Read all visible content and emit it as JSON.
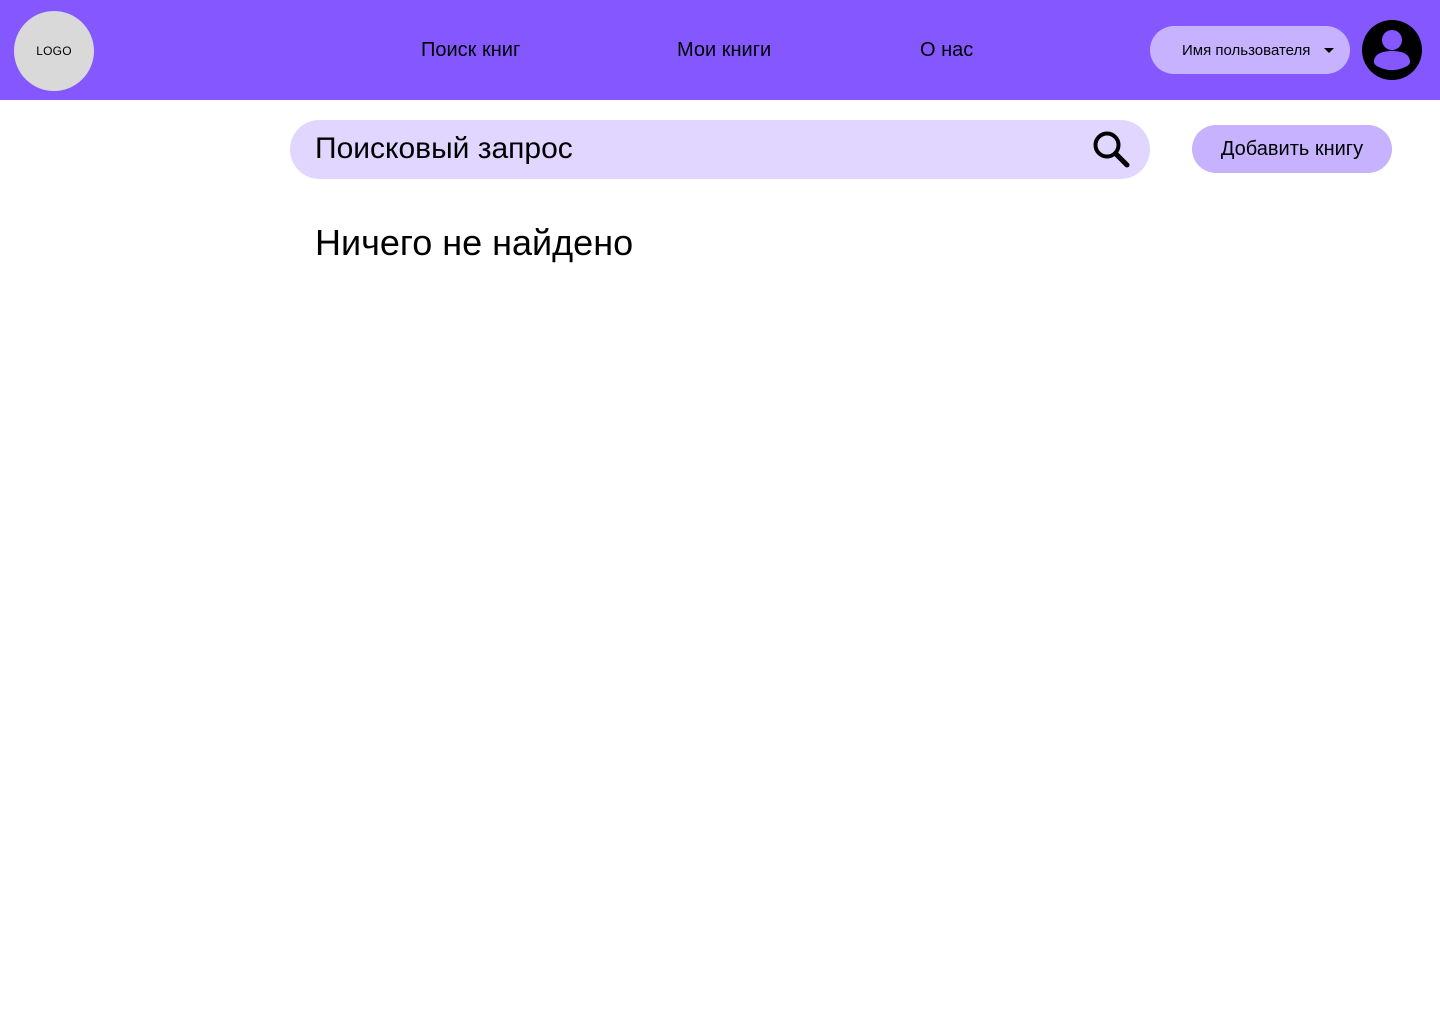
{
  "header": {
    "logo_text": "LOGO",
    "nav": [
      {
        "label": "Поиск книг"
      },
      {
        "label": "Мои книги"
      },
      {
        "label": "О нас"
      }
    ],
    "user_menu": {
      "label": "Имя пользователя",
      "caret_icon": "caret-down-icon"
    },
    "avatar_icon": "user-circle-icon"
  },
  "search": {
    "placeholder": "Поисковый запрос",
    "value": "",
    "icon": "search-icon"
  },
  "actions": {
    "add_book_label": "Добавить книгу"
  },
  "results": {
    "empty_message": "Ничего не найдено"
  },
  "colors": {
    "header_bg": "#8558ff",
    "button_bg": "#c6b2ff",
    "search_bg": "#e0d6ff",
    "logo_bg": "#d9d9d9"
  }
}
